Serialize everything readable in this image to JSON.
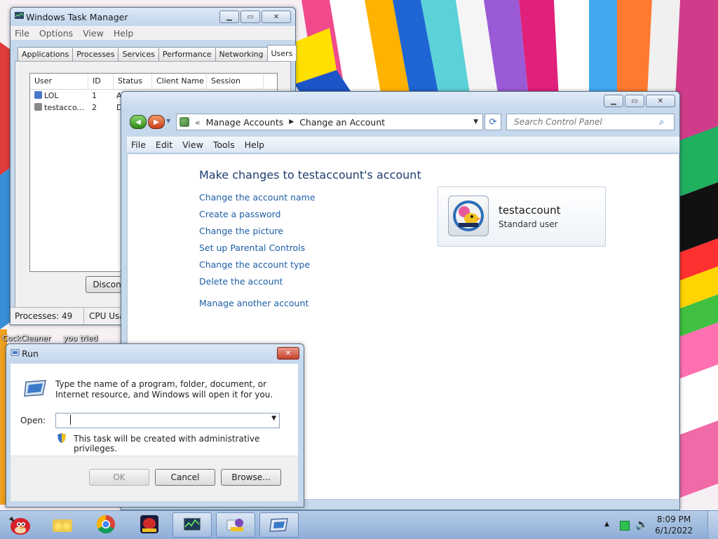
{
  "desktop": {
    "labels": [
      "CockCleaner",
      "you tried"
    ]
  },
  "task_manager": {
    "title": "Windows Task Manager",
    "menu": [
      "File",
      "Options",
      "View",
      "Help"
    ],
    "tabs": [
      "Applications",
      "Processes",
      "Services",
      "Performance",
      "Networking",
      "Users"
    ],
    "active_tab": "Users",
    "columns": [
      "User",
      "ID",
      "Status",
      "Client Name",
      "Session"
    ],
    "rows": [
      {
        "user": "LOL",
        "id": "1",
        "status": "A"
      },
      {
        "user": "testacco...",
        "id": "2",
        "status": "Di"
      }
    ],
    "disconnect_label": "Disconne",
    "status_processes": "Processes: 49",
    "status_cpu": "CPU Usa"
  },
  "control_panel": {
    "breadcrumb": [
      "Manage Accounts",
      "Change an Account"
    ],
    "search_placeholder": "Search Control Panel",
    "menu": [
      "File",
      "Edit",
      "View",
      "Tools",
      "Help"
    ],
    "heading": "Make changes to testaccount's account",
    "links": [
      "Change the account name",
      "Create a password",
      "Change the picture",
      "Set up Parental Controls",
      "Change the account type",
      "Delete the account"
    ],
    "manage_another": "Manage another account",
    "account": {
      "name": "testaccount",
      "type": "Standard user"
    }
  },
  "run_dialog": {
    "title": "Run",
    "description": "Type the name of a program, folder, document, or Internet resource, and Windows will open it for you.",
    "open_label": "Open:",
    "open_value": "",
    "admin_note": "This task will be created with administrative privileges.",
    "ok_label": "OK",
    "cancel_label": "Cancel",
    "browse_label": "Browse..."
  },
  "taskbar": {
    "time": "8:09 PM",
    "date": "6/1/2022"
  },
  "colors": {
    "link": "#1e5ea8",
    "heading": "#1e3d6e",
    "taskbar": "#a5bfe2"
  }
}
